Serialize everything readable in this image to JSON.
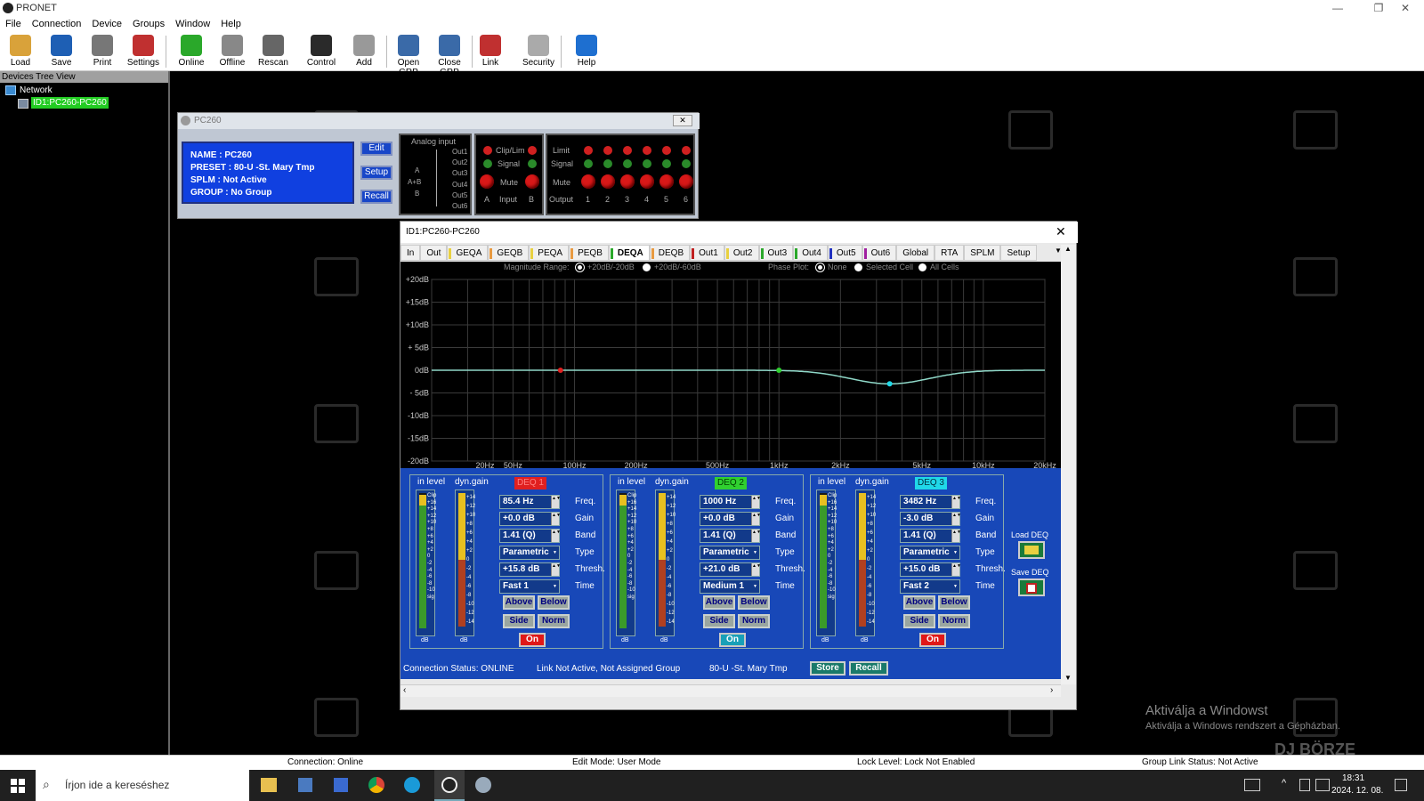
{
  "app": {
    "title": "PRONET",
    "menu": [
      "File",
      "Connection",
      "Device",
      "Groups",
      "Window",
      "Help"
    ]
  },
  "toolbar": [
    {
      "label": "Load",
      "icon": "folder-icon",
      "color": "#d9a23a"
    },
    {
      "label": "Save",
      "icon": "floppy-icon",
      "color": "#1e5fb4"
    },
    {
      "label": "Print",
      "icon": "printer-icon",
      "color": "#777"
    },
    {
      "label": "Settings",
      "icon": "tools-icon",
      "color": "#c03030"
    },
    {
      "label": "Online",
      "icon": "online-icon",
      "color": "#2aa82a"
    },
    {
      "label": "Offline",
      "icon": "offline-icon",
      "color": "#888"
    },
    {
      "label": "Rescan",
      "icon": "magnifier-icon",
      "color": "#666"
    },
    {
      "label": "Control",
      "icon": "monitor-icon",
      "color": "#2a2a2a"
    },
    {
      "label": "Add",
      "icon": "add-device-icon",
      "color": "#999"
    },
    {
      "label": "Open GRP",
      "icon": "open-group-icon",
      "color": "#3a6aa8"
    },
    {
      "label": "Close GRP",
      "icon": "close-group-icon",
      "color": "#3a6aa8"
    },
    {
      "label": "Link",
      "icon": "link-icon",
      "color": "#c03030"
    },
    {
      "label": "Security",
      "icon": "lock-icon",
      "color": "#aaa"
    },
    {
      "label": "Help",
      "icon": "help-icon",
      "color": "#1e6fd0"
    }
  ],
  "tree": {
    "header": "Devices Tree View",
    "root": "Network",
    "device": "ID1:PC260-PC260"
  },
  "pc260": {
    "title": "PC260",
    "info": [
      "NAME   : PC260",
      "PRESET : 80-U -St. Mary Tmp",
      "SPLM    : Not Active",
      "GROUP : No Group"
    ],
    "buttons": [
      "Edit",
      "Setup",
      "Recall"
    ],
    "routing": {
      "label": "Analog input",
      "outs": [
        "Out1",
        "Out2",
        "Out3",
        "Out4",
        "Out5",
        "Out6"
      ],
      "ins": [
        "A",
        "A+B",
        "B"
      ]
    },
    "input_panel": {
      "clip": "Clip/Lim",
      "signal": "Signal",
      "mute": "Mute",
      "label": "Input",
      "a": "A",
      "b": "B"
    },
    "output_panel": {
      "limit": "Limit",
      "signal": "Signal",
      "mute": "Mute",
      "label": "Output",
      "channels": [
        "1",
        "2",
        "3",
        "4",
        "5",
        "6"
      ]
    }
  },
  "deq": {
    "title": "ID1:PC260-PC260",
    "tabs": [
      {
        "label": "In",
        "mark": ""
      },
      {
        "label": "Out",
        "mark": ""
      },
      {
        "label": "GEQA",
        "mark": "#e8d040"
      },
      {
        "label": "GEQB",
        "mark": "#e89a40"
      },
      {
        "label": "PEQA",
        "mark": "#e8d040"
      },
      {
        "label": "PEQB",
        "mark": "#e89a40"
      },
      {
        "label": "DEQA",
        "mark": "#2aa82a"
      },
      {
        "label": "DEQB",
        "mark": "#e89a40"
      },
      {
        "label": "Out1",
        "mark": "#c02020"
      },
      {
        "label": "Out2",
        "mark": "#e8d040"
      },
      {
        "label": "Out3",
        "mark": "#2aa82a"
      },
      {
        "label": "Out4",
        "mark": "#2aa82a"
      },
      {
        "label": "Out5",
        "mark": "#2030c0"
      },
      {
        "label": "Out6",
        "mark": "#a020a0"
      },
      {
        "label": "Global",
        "mark": ""
      },
      {
        "label": "RTA",
        "mark": ""
      },
      {
        "label": "SPLM",
        "mark": ""
      },
      {
        "label": "Setup",
        "mark": ""
      }
    ],
    "active_tab": "DEQA",
    "magnitude": {
      "label": "Magnitude Range:",
      "opt1": "+20dB/-20dB",
      "opt2": "+20dB/-60dB"
    },
    "phase": {
      "label": "Phase Plot:",
      "opt1": "None",
      "opt2": "Selected Cell",
      "opt3": "All Cells"
    },
    "graph": {
      "y_ticks": [
        "+20dB",
        "+15dB",
        "+10dB",
        "+ 5dB",
        "0dB",
        "- 5dB",
        "-10dB",
        "-15dB",
        "-20dB"
      ],
      "x_ticks": [
        "20Hz",
        "50Hz",
        "100Hz",
        "200Hz",
        "500Hz",
        "1kHz",
        "2kHz",
        "5kHz",
        "10kHz",
        "20kHz"
      ],
      "curve_color": "#8fd8c8"
    },
    "blocks": [
      {
        "badge": "DEQ 1",
        "badge_color": "#e02020",
        "badge_text": "#ff8080",
        "freq": "85.4 Hz",
        "gain": "+0.0 dB",
        "band": "1.41 (Q)",
        "type": "Parametric",
        "thresh": "+15.8 dB",
        "time": "Fast 1",
        "on": "On",
        "on_color": "#e01818"
      },
      {
        "badge": "DEQ 2",
        "badge_color": "#30d030",
        "badge_text": "#004000",
        "freq": "1000 Hz",
        "gain": "+0.0 dB",
        "band": "1.41 (Q)",
        "type": "Parametric",
        "thresh": "+21.0 dB",
        "time": "Medium 1",
        "on": "On",
        "on_color": "#18a0b8"
      },
      {
        "badge": "DEQ 3",
        "badge_color": "#20d8e8",
        "badge_text": "#003040",
        "freq": "3482 Hz",
        "gain": "-3.0 dB",
        "band": "1.41 (Q)",
        "type": "Parametric",
        "thresh": "+15.0 dB",
        "time": "Fast 2",
        "on": "On",
        "on_color": "#e01818"
      }
    ],
    "field_labels": {
      "freq": "Freq.",
      "gain": "Gain",
      "band": "Band",
      "type": "Type",
      "thresh": "Thresh.",
      "time": "Time"
    },
    "meter_labels": {
      "in": "in level",
      "dyn": "dyn.gain",
      "db": "dB"
    },
    "in_scale": [
      "Clip",
      "+16",
      "+14",
      "+12",
      "+10",
      "+8",
      "+6",
      "+4",
      "+2",
      "0",
      "-2",
      "-4",
      "-6",
      "-8",
      "-10",
      "sig"
    ],
    "dyn_scale": [
      "+14",
      "+12",
      "+10",
      "+8",
      "+6",
      "+4",
      "+2",
      "0",
      "-2",
      "-4",
      "-6",
      "-8",
      "-10",
      "-12",
      "-14"
    ],
    "buttons": {
      "above": "Above",
      "below": "Below",
      "side": "Side",
      "norm": "Norm"
    },
    "load_deq": "Load DEQ",
    "save_deq": "Save DEQ",
    "status": {
      "conn": "Connection Status: ONLINE",
      "link": "Link Not Active,  Not Assigned Group",
      "preset": "80-U -St. Mary Tmp",
      "store": "Store",
      "recall": "Recall"
    }
  },
  "statusbar": {
    "conn": "Connection: Online",
    "edit": "Edit Mode: User Mode",
    "lock": "Lock Level: Lock Not Enabled",
    "group": "Group Link Status: Not Active"
  },
  "watermark": {
    "activate": "Aktiválja a Windowst",
    "activate_sub": "Aktiválja a Windows rendszert a Gépházban.",
    "brand": "DJ BÖRZE"
  },
  "taskbar": {
    "search": "Írjon ide a kereséshez",
    "time": "18:31",
    "date": "2024. 12. 08."
  }
}
